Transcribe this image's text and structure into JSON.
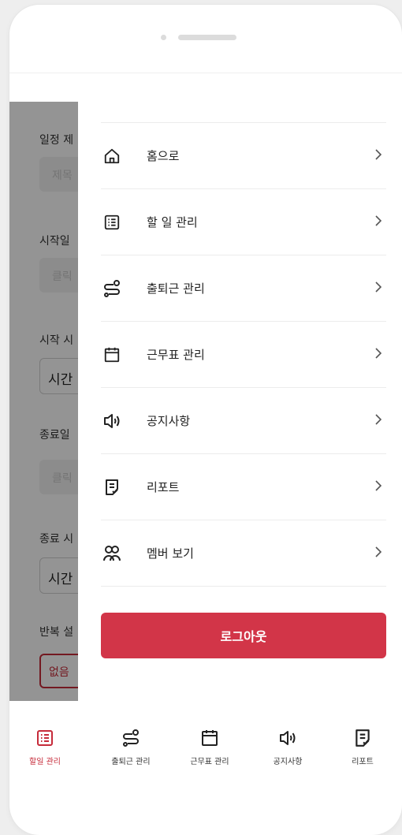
{
  "form": {
    "labels": [
      "일정 제",
      "시작일",
      "시작 시",
      "종료일",
      "종료 시",
      "반복 설"
    ],
    "title_placeholder": "제목",
    "start_date_placeholder": "클릭",
    "start_time_value": "시간",
    "end_date_placeholder": "클릭",
    "end_time_value": "시간",
    "repeat_value": "없음"
  },
  "drawer": {
    "items": [
      {
        "label": "홈으로",
        "icon": "home-icon"
      },
      {
        "label": "할 일 관리",
        "icon": "task-list-icon"
      },
      {
        "label": "출퇴근 관리",
        "icon": "route-icon"
      },
      {
        "label": "근무표 관리",
        "icon": "calendar-icon"
      },
      {
        "label": "공지사항",
        "icon": "megaphone-icon"
      },
      {
        "label": "리포트",
        "icon": "report-icon"
      },
      {
        "label": "멤버 보기",
        "icon": "members-icon"
      }
    ],
    "logout_label": "로그아웃"
  },
  "tabbar": {
    "tabs": [
      {
        "label": "할일 관리",
        "icon": "task-list-icon",
        "active": true
      },
      {
        "label": "출퇴근 관리",
        "icon": "route-icon",
        "active": false
      },
      {
        "label": "근무표 관리",
        "icon": "calendar-icon",
        "active": false
      },
      {
        "label": "공지사항",
        "icon": "megaphone-icon",
        "active": false
      },
      {
        "label": "리포트",
        "icon": "report-icon",
        "active": false
      }
    ]
  },
  "colors": {
    "accent": "#d23548",
    "active_tab": "#c62b3a",
    "overlay": "rgba(0,0,0,0.42)"
  }
}
